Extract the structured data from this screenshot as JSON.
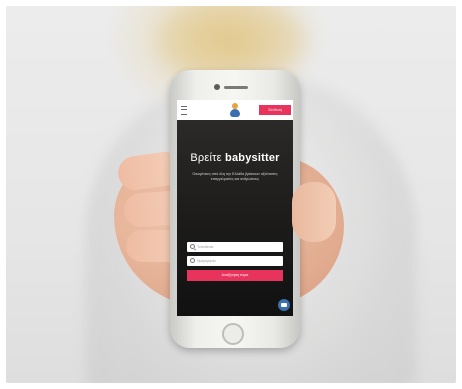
{
  "app": {
    "login_label": "Σύνδεση",
    "hero_title_prefix": "Βρείτε",
    "hero_title_brand": "babysitter",
    "hero_subtitle": "Οικογένειες από όλη την Ελλάδα βρίσκουν αξιόπιστες επαγγελματίες και ανθρώπους",
    "location_placeholder": "Τοποθεσία",
    "date_placeholder": "Ημερομηνία",
    "search_label": "Αναζήτηση τώρα"
  },
  "colors": {
    "accent": "#e8335d",
    "brand_blue": "#3a6fb0",
    "brand_orange": "#e8a33c"
  },
  "icons": [
    "menu-icon",
    "logo-icon",
    "search-icon",
    "clock-icon",
    "chat-icon"
  ]
}
